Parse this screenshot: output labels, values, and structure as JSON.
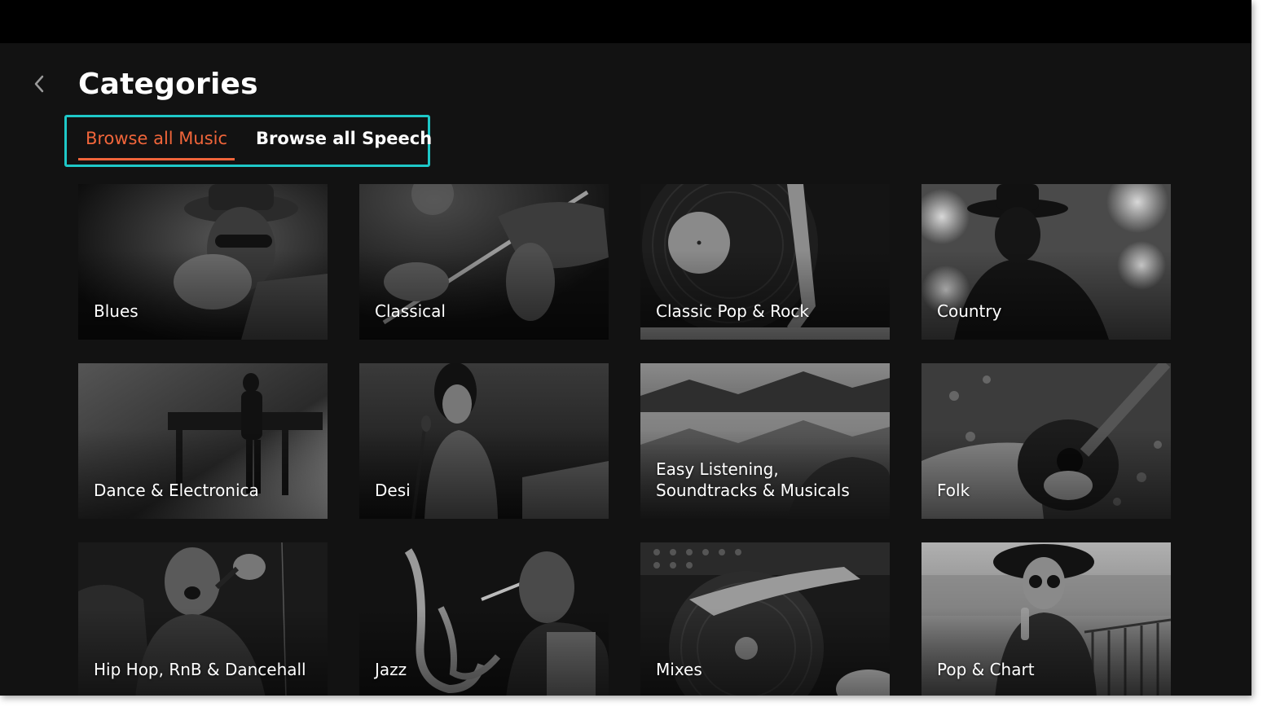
{
  "header": {
    "title": "Categories"
  },
  "tabs": [
    {
      "label": "Browse all Music",
      "active": true
    },
    {
      "label": "Browse all Speech",
      "active": false
    }
  ],
  "colors": {
    "accent": "#f0653a",
    "focus_ring": "#1ec8c8",
    "background": "#121212"
  },
  "categories": [
    {
      "label": "Blues"
    },
    {
      "label": "Classical"
    },
    {
      "label": "Classic Pop & Rock"
    },
    {
      "label": "Country"
    },
    {
      "label": "Dance & Electronica"
    },
    {
      "label": "Desi"
    },
    {
      "label": "Easy Listening, Soundtracks & Musicals"
    },
    {
      "label": "Folk"
    },
    {
      "label": "Hip Hop, RnB & Dancehall"
    },
    {
      "label": "Jazz"
    },
    {
      "label": "Mixes"
    },
    {
      "label": "Pop & Chart"
    }
  ]
}
